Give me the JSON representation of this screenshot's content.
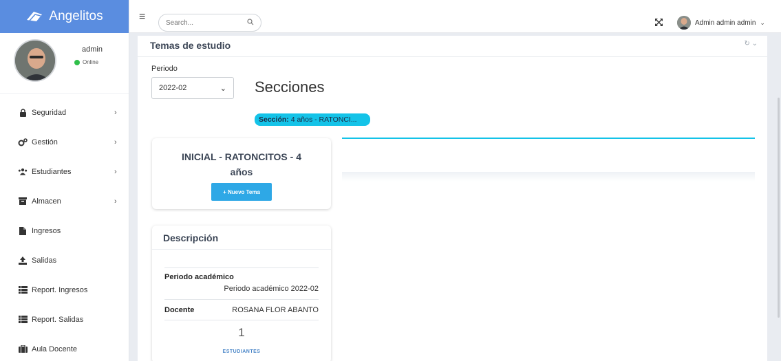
{
  "brand": {
    "name": "Angelitos"
  },
  "user_panel": {
    "name": "admin",
    "status": "Online"
  },
  "sidebar": {
    "items": [
      {
        "label": "Seguridad",
        "icon": "lock-icon",
        "has_children": true
      },
      {
        "label": "Gestión",
        "icon": "cogs-icon",
        "has_children": true
      },
      {
        "label": "Estudiantes",
        "icon": "users-icon",
        "has_children": true
      },
      {
        "label": "Almacen",
        "icon": "archive-icon",
        "has_children": true
      },
      {
        "label": "Ingresos",
        "icon": "file-icon",
        "has_children": false
      },
      {
        "label": "Salidas",
        "icon": "upload-icon",
        "has_children": false
      },
      {
        "label": "Report. Ingresos",
        "icon": "list-icon",
        "has_children": false
      },
      {
        "label": "Report. Salidas",
        "icon": "list-icon",
        "has_children": false
      },
      {
        "label": "Aula Docente",
        "icon": "briefcase-icon",
        "has_children": false
      }
    ]
  },
  "topbar": {
    "search_placeholder": "Search...",
    "user_label": "Admin admin admin"
  },
  "main": {
    "title": "Temas de estudio",
    "periodo_label": "Periodo",
    "periodo_value": "2022-02",
    "secciones_title": "Secciones",
    "section_pill_label": "Sección:",
    "section_pill_value": "4 años - RATONCI..."
  },
  "course_card": {
    "title": "INICIAL - RATONCITOS - 4 años",
    "new_topic_button": "+ Nuevo Tema"
  },
  "description_card": {
    "heading": "Descripción",
    "periodo_label": "Periodo académico",
    "periodo_value": "Periodo académico 2022-02",
    "docente_label": "Docente",
    "docente_value": "ROSANA FLOR ABANTO",
    "student_count": "1",
    "student_label": "ESTUDIANTES"
  },
  "colors": {
    "brand_bg": "#5a8de0",
    "accent_cyan": "#14c3e8",
    "button_blue": "#2ea8e6",
    "online_green": "#2fbf4a"
  }
}
